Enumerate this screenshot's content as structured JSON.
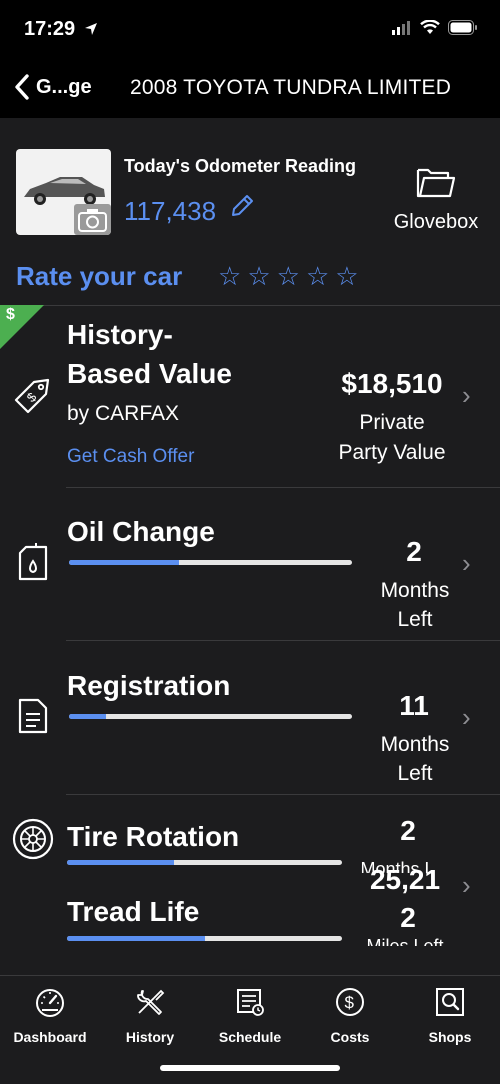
{
  "status_bar": {
    "time": "17:29"
  },
  "nav": {
    "back_label": "G...ge",
    "title": "2008 TOYOTA TUNDRA LIMITED"
  },
  "odometer": {
    "label": "Today's Odometer Reading",
    "value": "117,438"
  },
  "glovebox": {
    "label": "Glovebox"
  },
  "rating": {
    "label": "Rate your car",
    "stars": 5,
    "filled": 0
  },
  "value_card": {
    "title_line1": "History-",
    "title_line2": "Based Value",
    "by": "by CARFAX",
    "link": "Get Cash Offer",
    "amount": "$18,510",
    "amount_sub1": "Private",
    "amount_sub2": "Party Value",
    "tag_glyph": "$"
  },
  "oil_change": {
    "title": "Oil Change",
    "value": "2",
    "sub1": "Months",
    "sub2": "Left",
    "progress": 0.39
  },
  "registration": {
    "title": "Registration",
    "value": "11",
    "sub1": "Months",
    "sub2": "Left",
    "progress": 0.13
  },
  "tire_rotation": {
    "title": "Tire Rotation",
    "value": "2",
    "sub": "Months L...",
    "progress": 0.39
  },
  "tread_life": {
    "title": "Tread Life",
    "value_overlap": "25,21",
    "value": "2",
    "sub": "Miles Left",
    "progress": 0.5
  },
  "tabs": [
    {
      "label": "Dashboard",
      "icon": "dashboard-icon"
    },
    {
      "label": "History",
      "icon": "history-icon"
    },
    {
      "label": "Schedule",
      "icon": "schedule-icon"
    },
    {
      "label": "Costs",
      "icon": "costs-icon"
    },
    {
      "label": "Shops",
      "icon": "shops-icon"
    }
  ],
  "colors": {
    "accent": "#5b8ff0",
    "background": "#1c1c1e",
    "tag": "#4caf50"
  }
}
